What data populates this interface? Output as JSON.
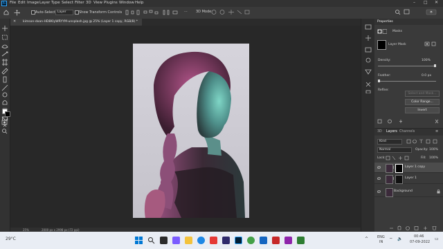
{
  "menubar": {
    "items": [
      "File",
      "Edit",
      "Image",
      "Layer",
      "Type",
      "Select",
      "Filter",
      "3D",
      "View",
      "Plugins",
      "Window",
      "Help"
    ]
  },
  "options": {
    "auto_select": "Auto-Select:",
    "target": "Layer",
    "show_transform": "Show Transform Controls"
  },
  "document": {
    "tab_title": "kimson-doan-HD8KlyWRYYM-unsplash.jpg @ 25% (Layer 1 copy, RGB/8) *",
    "zoom": "25%",
    "doc_size": "2000 px x 2998 px (72 ppi)"
  },
  "properties": {
    "title": "Properties",
    "masks_label": "Masks",
    "layer_mask": "Layer Mask",
    "density_label": "Density:",
    "density_value": "100%",
    "feather_label": "Feather:",
    "feather_value": "0.0 px",
    "refine_label": "Refine:",
    "select_mask": "Select and Mask...",
    "color_range": "Color Range...",
    "invert": "Invert"
  },
  "layers_panel": {
    "tabs": [
      "3D",
      "Layers",
      "Channels"
    ],
    "kind": "Kind",
    "blend_mode": "Normal",
    "opacity_label": "Opacity:",
    "opacity_value": "100%",
    "lock_label": "Lock:",
    "fill_label": "Fill:",
    "fill_value": "100%",
    "layers": [
      "Layer 1 copy",
      "Layer 1",
      "Background"
    ]
  },
  "taskbar": {
    "weather": "29°C",
    "lang": "ENG",
    "region": "IN",
    "time": "00:46",
    "date": "07-09-2022"
  },
  "colors": {
    "accent_blue": "#31a8ff",
    "panel_bg": "#3a3a3a",
    "canvas_bg": "#282828"
  }
}
